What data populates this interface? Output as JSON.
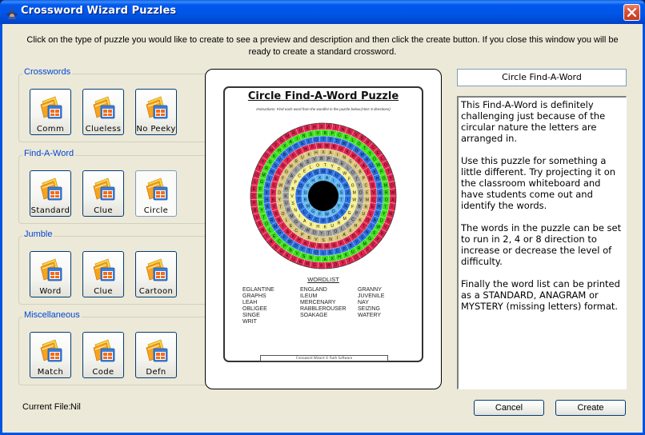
{
  "window": {
    "title": "Crossword Wizard Puzzles",
    "close_label": "Close"
  },
  "instructions": "Click on the type of puzzle you would like to create to see a preview and description and then click the create button. If you close this window you will be ready to create a standard crossword.",
  "groups": [
    {
      "label": "Crosswords",
      "tiles": [
        {
          "label": "Comm",
          "selected": false
        },
        {
          "label": "Clueless",
          "selected": false
        },
        {
          "label": "No Peeky",
          "selected": false
        }
      ]
    },
    {
      "label": "Find-A-Word",
      "tiles": [
        {
          "label": "Standard",
          "selected": false
        },
        {
          "label": "Clue",
          "selected": false
        },
        {
          "label": "Circle",
          "selected": true
        }
      ]
    },
    {
      "label": "Jumble",
      "tiles": [
        {
          "label": "Word",
          "selected": false
        },
        {
          "label": "Clue",
          "selected": false
        },
        {
          "label": "Cartoon",
          "selected": false
        }
      ]
    },
    {
      "label": "Miscellaneous",
      "tiles": [
        {
          "label": "Match",
          "selected": false
        },
        {
          "label": "Code",
          "selected": false
        },
        {
          "label": "Defn",
          "selected": false
        }
      ]
    }
  ],
  "preview": {
    "title": "Circle Find-A-Word Puzzle",
    "instructions": "Instructions: Find each word from the wordlist in the puzzle below.(Hint: 8 directions)",
    "ring_colors": [
      "#e0234e",
      "#3be01a",
      "#2a6fe0",
      "#e0234e",
      "#d9c57a",
      "#9a9a9a",
      "#f5ef8a",
      "#2a6fe0",
      "#5ab4f0"
    ],
    "center_color": "#000000",
    "wordlist_title": "WORDLIST",
    "wordlist_columns": [
      [
        "EGLANTINE",
        "GRAPHS",
        "LEAH",
        "OBLIGEE",
        "SINGE",
        "WRIT"
      ],
      [
        "ENGLAND",
        "ILEUM",
        "MERCENARY",
        "RABBLEROUSER",
        "SOAKAGE"
      ],
      [
        "GRANNY",
        "JUVENILE",
        "NAY",
        "SEIZING",
        "WATERY"
      ]
    ],
    "footer": "Crossword Wizard © Ruth Software"
  },
  "selected_name": "Circle Find-A-Word",
  "description": [
    "This Find-A-Word is definitely challenging just because of the circular nature the letters are arranged in.",
    "Use this puzzle for something a little different. Try projecting it on the classroom whiteboard and have students come out and identify the words.",
    "The words in the puzzle can be set to run in 2, 4 or 8 direction to increase or decrease the level of difficulty.",
    "Finally the word list can be printed as a STANDARD, ANAGRAM or MYSTERY (missing letters) format."
  ],
  "status": {
    "current_file_label": "Current File:",
    "current_file_value": "Nil"
  },
  "buttons": {
    "cancel": "Cancel",
    "create": "Create"
  }
}
